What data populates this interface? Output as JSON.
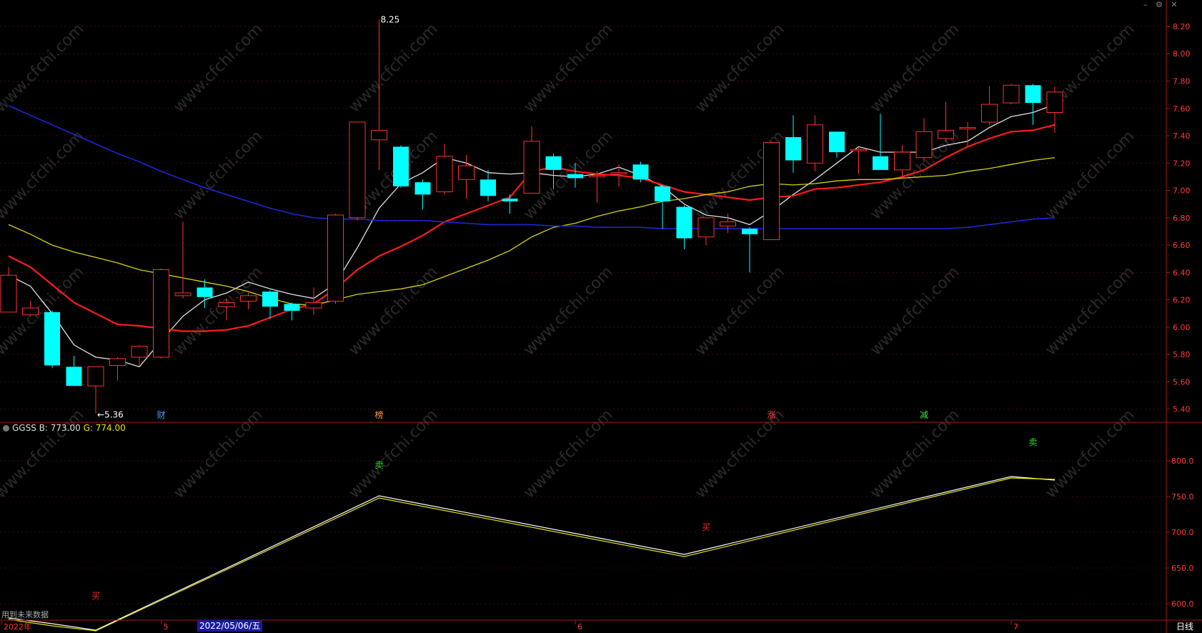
{
  "header": {
    "title": "",
    "items": [],
    "controls": [
      "minimize-icon",
      "settings-icon",
      "close-icon"
    ]
  },
  "indicator": {
    "name": "GGSS",
    "b_label": "B:",
    "b_value": "773.00",
    "g_label": "G:",
    "g_value": "774.00"
  },
  "footer": {
    "note": "用到未来数据",
    "period": "日线",
    "selected_date": "2022/05/06/五"
  },
  "colors": {
    "background": "#000000",
    "border": "#b01515",
    "up": "#ff3030",
    "down": "#00ffff",
    "ma_white": "#e0e0e0",
    "ma_red": "#ff1a1a",
    "ma_yellow": "#d4d400",
    "ma_blue": "#1a28d6"
  },
  "chart_data": [
    {
      "type": "candlestick",
      "title": "",
      "watermark": "www.cfchi.com",
      "y_ticks": [
        "8.20",
        "8.00",
        "7.80",
        "7.60",
        "7.40",
        "7.20",
        "7.00",
        "6.80",
        "6.60",
        "6.40",
        "6.20",
        "6.00",
        "5.80",
        "5.60",
        "5.40"
      ],
      "ylim": [
        5.32,
        8.32
      ],
      "x_labels": [
        {
          "index": 0,
          "label": "2022年"
        },
        {
          "index": 7,
          "label": "5"
        },
        {
          "index": 26,
          "label": "6"
        },
        {
          "index": 46,
          "label": "7"
        }
      ],
      "annotations": [
        {
          "index": 4,
          "value": 5.36,
          "label": "←5.36"
        },
        {
          "index": 17,
          "value": 8.25,
          "label": "8.25"
        }
      ],
      "event_markers": [
        {
          "index": 7,
          "label": "财",
          "color": "#4aa3ff"
        },
        {
          "index": 17,
          "label": "榜",
          "color": "#ff9a3c"
        },
        {
          "index": 35,
          "label": "涨",
          "color": "#ff4040"
        },
        {
          "index": 42,
          "label": "减",
          "color": "#40e040"
        }
      ],
      "candles": [
        {
          "o": 6.11,
          "c": 6.38,
          "h": 6.44,
          "l": 6.11
        },
        {
          "o": 6.09,
          "c": 6.14,
          "h": 6.19,
          "l": 6.08
        },
        {
          "o": 6.11,
          "c": 5.72,
          "h": 6.12,
          "l": 5.7
        },
        {
          "o": 5.71,
          "c": 5.57,
          "h": 5.79,
          "l": 5.57
        },
        {
          "o": 5.57,
          "c": 5.71,
          "h": 5.71,
          "l": 5.37
        },
        {
          "o": 5.72,
          "c": 5.77,
          "h": 5.78,
          "l": 5.61
        },
        {
          "o": 5.78,
          "c": 5.86,
          "h": 5.87,
          "l": 5.72
        },
        {
          "o": 5.78,
          "c": 6.42,
          "h": 6.43,
          "l": 5.77
        },
        {
          "o": 6.23,
          "c": 6.25,
          "h": 6.77,
          "l": 6.21
        },
        {
          "o": 6.29,
          "c": 6.22,
          "h": 6.35,
          "l": 6.14
        },
        {
          "o": 6.15,
          "c": 6.18,
          "h": 6.21,
          "l": 6.05
        },
        {
          "o": 6.19,
          "c": 6.23,
          "h": 6.25,
          "l": 6.13
        },
        {
          "o": 6.26,
          "c": 6.15,
          "h": 6.27,
          "l": 6.06
        },
        {
          "o": 6.17,
          "c": 6.12,
          "h": 6.18,
          "l": 6.05
        },
        {
          "o": 6.14,
          "c": 6.18,
          "h": 6.29,
          "l": 6.09
        },
        {
          "o": 6.19,
          "c": 6.82,
          "h": 6.83,
          "l": 6.17
        },
        {
          "o": 6.8,
          "c": 7.5,
          "h": 7.5,
          "l": 6.78
        },
        {
          "o": 7.37,
          "c": 7.44,
          "h": 8.25,
          "l": 7.15
        },
        {
          "o": 7.32,
          "c": 7.03,
          "h": 7.33,
          "l": 7.02
        },
        {
          "o": 7.06,
          "c": 6.97,
          "h": 7.08,
          "l": 6.86
        },
        {
          "o": 6.99,
          "c": 7.25,
          "h": 7.34,
          "l": 6.97
        },
        {
          "o": 7.08,
          "c": 7.18,
          "h": 7.26,
          "l": 6.94
        },
        {
          "o": 7.08,
          "c": 6.96,
          "h": 7.15,
          "l": 6.92
        },
        {
          "o": 6.94,
          "c": 6.92,
          "h": 6.97,
          "l": 6.83
        },
        {
          "o": 6.98,
          "c": 7.36,
          "h": 7.47,
          "l": 6.98
        },
        {
          "o": 7.25,
          "c": 7.15,
          "h": 7.27,
          "l": 7.01
        },
        {
          "o": 7.12,
          "c": 7.09,
          "h": 7.2,
          "l": 7.02
        },
        {
          "o": 7.1,
          "c": 7.11,
          "h": 7.14,
          "l": 6.91
        },
        {
          "o": 7.12,
          "c": 7.13,
          "h": 7.19,
          "l": 7.03
        },
        {
          "o": 7.19,
          "c": 7.08,
          "h": 7.21,
          "l": 7.06
        },
        {
          "o": 7.03,
          "c": 6.92,
          "h": 7.04,
          "l": 6.72
        },
        {
          "o": 6.88,
          "c": 6.65,
          "h": 6.89,
          "l": 6.57
        },
        {
          "o": 6.66,
          "c": 6.8,
          "h": 6.8,
          "l": 6.6
        },
        {
          "o": 6.74,
          "c": 6.77,
          "h": 6.83,
          "l": 6.69
        },
        {
          "o": 6.72,
          "c": 6.68,
          "h": 6.73,
          "l": 6.4
        },
        {
          "o": 6.64,
          "c": 7.35,
          "h": 7.35,
          "l": 6.64
        },
        {
          "o": 7.39,
          "c": 7.22,
          "h": 7.55,
          "l": 7.13
        },
        {
          "o": 7.2,
          "c": 7.48,
          "h": 7.55,
          "l": 7.14
        },
        {
          "o": 7.43,
          "c": 7.28,
          "h": 7.43,
          "l": 7.24
        },
        {
          "o": 7.29,
          "c": 7.3,
          "h": 7.31,
          "l": 7.12
        },
        {
          "o": 7.25,
          "c": 7.15,
          "h": 7.56,
          "l": 7.15
        },
        {
          "o": 7.15,
          "c": 7.28,
          "h": 7.33,
          "l": 7.09
        },
        {
          "o": 7.24,
          "c": 7.43,
          "h": 7.53,
          "l": 7.21
        },
        {
          "o": 7.38,
          "c": 7.44,
          "h": 7.65,
          "l": 7.36
        },
        {
          "o": 7.45,
          "c": 7.46,
          "h": 7.5,
          "l": 7.32
        },
        {
          "o": 7.5,
          "c": 7.63,
          "h": 7.76,
          "l": 7.48
        },
        {
          "o": 7.64,
          "c": 7.77,
          "h": 7.78,
          "l": 7.63
        },
        {
          "o": 7.77,
          "c": 7.64,
          "h": 7.78,
          "l": 7.48
        },
        {
          "o": 7.57,
          "c": 7.72,
          "h": 7.76,
          "l": 7.42
        }
      ],
      "series": [
        {
          "values": [
            6.38,
            6.3,
            6.1,
            5.87,
            5.78,
            5.76,
            5.71,
            5.9,
            6.08,
            6.2,
            6.25,
            6.33,
            6.28,
            6.24,
            6.21,
            6.32,
            6.58,
            6.87,
            7.05,
            7.13,
            7.24,
            7.2,
            7.13,
            7.12,
            7.13,
            7.11,
            7.1,
            7.12,
            7.17,
            7.11,
            7.03,
            6.9,
            6.82,
            6.8,
            6.75,
            6.85,
            6.97,
            7.08,
            7.2,
            7.32,
            7.28,
            7.28,
            7.28,
            7.33,
            7.36,
            7.46,
            7.54,
            7.57,
            7.63
          ]
        },
        {
          "values": [
            6.52,
            6.44,
            6.31,
            6.18,
            6.1,
            6.02,
            6.01,
            5.99,
            5.97,
            5.97,
            5.98,
            6.01,
            6.07,
            6.13,
            6.17,
            6.28,
            6.42,
            6.52,
            6.59,
            6.67,
            6.77,
            6.83,
            6.89,
            6.95,
            7.14,
            7.17,
            7.14,
            7.12,
            7.11,
            7.09,
            7.04,
            6.99,
            6.97,
            6.95,
            6.93,
            6.95,
            6.96,
            7.01,
            7.02,
            7.04,
            7.06,
            7.1,
            7.15,
            7.24,
            7.32,
            7.38,
            7.43,
            7.44,
            7.48
          ]
        },
        {
          "values": [
            6.75,
            6.68,
            6.6,
            6.55,
            6.51,
            6.47,
            6.42,
            6.39,
            6.36,
            6.33,
            6.3,
            6.26,
            6.21,
            6.17,
            6.16,
            6.2,
            6.24,
            6.26,
            6.28,
            6.31,
            6.37,
            6.43,
            6.49,
            6.56,
            6.66,
            6.73,
            6.76,
            6.81,
            6.85,
            6.88,
            6.92,
            6.94,
            6.97,
            6.99,
            7.03,
            7.05,
            7.04,
            7.05,
            7.07,
            7.08,
            7.08,
            7.09,
            7.1,
            7.11,
            7.14,
            7.16,
            7.19,
            7.22,
            7.24
          ]
        },
        {
          "values": [
            7.62,
            7.55,
            7.48,
            7.41,
            7.34,
            7.27,
            7.21,
            7.14,
            7.08,
            7.02,
            6.97,
            6.92,
            6.87,
            6.83,
            6.8,
            6.79,
            6.79,
            6.78,
            6.78,
            6.78,
            6.77,
            6.76,
            6.75,
            6.75,
            6.75,
            6.74,
            6.74,
            6.73,
            6.73,
            6.73,
            6.72,
            6.72,
            6.72,
            6.72,
            6.72,
            6.72,
            6.72,
            6.72,
            6.72,
            6.72,
            6.72,
            6.72,
            6.72,
            6.72,
            6.73,
            6.75,
            6.77,
            6.79,
            6.8
          ]
        }
      ]
    },
    {
      "type": "line",
      "title": "GGSS",
      "y_ticks": [
        "800.0",
        "750.0",
        "700.0",
        "650.0",
        "600.0"
      ],
      "ylim": [
        577,
        837
      ],
      "x": [
        0,
        2,
        4,
        17,
        31,
        46,
        48
      ],
      "series": [
        {
          "name": "B",
          "values": [
            580,
            572,
            563,
            751,
            669,
            778,
            773
          ]
        },
        {
          "name": "G",
          "values": [
            578,
            569,
            562,
            748,
            666,
            776,
            774
          ]
        }
      ],
      "signals": [
        {
          "index": 4,
          "value": 607,
          "label": "买",
          "color": "#ff2020"
        },
        {
          "index": 17,
          "value": 790,
          "label": "卖",
          "color": "#20e020"
        },
        {
          "index": 32,
          "value": 703,
          "label": "买",
          "color": "#ff2020"
        },
        {
          "index": 47,
          "value": 822,
          "label": "卖",
          "color": "#20e020"
        }
      ]
    }
  ]
}
